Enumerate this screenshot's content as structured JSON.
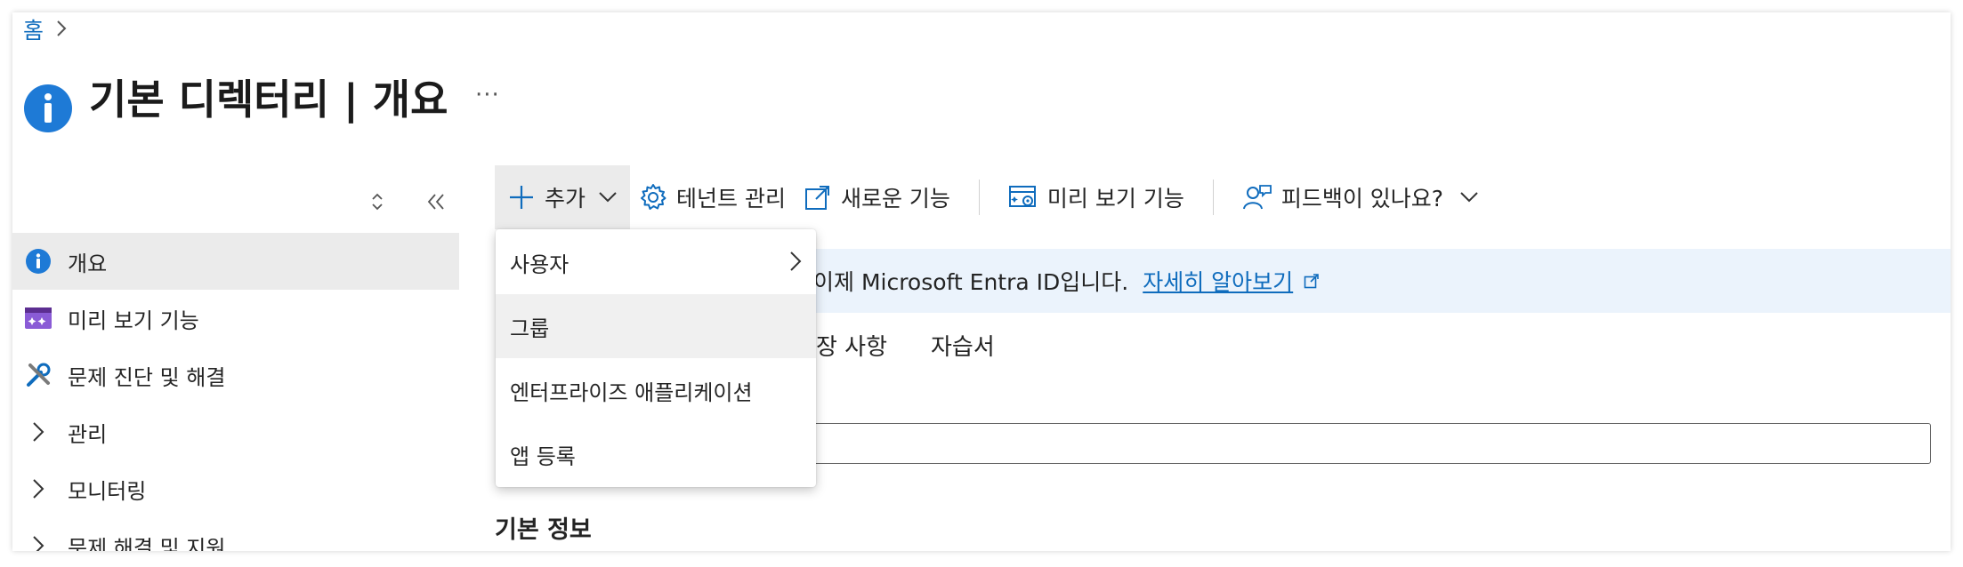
{
  "breadcrumb": {
    "home": "홈",
    "separator": ">"
  },
  "page": {
    "title": "기본 디렉터리 | 개요",
    "more": "···"
  },
  "sidebar": {
    "items": [
      {
        "label": "개요",
        "icon": "info-icon"
      },
      {
        "label": "미리 보기 기능",
        "icon": "preview-features-icon"
      },
      {
        "label": "문제 진단 및 해결",
        "icon": "wrench-tools-icon"
      },
      {
        "label": "관리",
        "icon": "chevron-right-icon"
      },
      {
        "label": "모니터링",
        "icon": "chevron-right-icon"
      },
      {
        "label": "문제 해결 및 지원",
        "icon": "chevron-right-icon"
      }
    ]
  },
  "toolbar": {
    "add": "추가",
    "tenant": "테넌트 관리",
    "whats_new": "새로운 기능",
    "preview": "미리 보기 기능",
    "feedback": "피드백이 있나요?"
  },
  "dropdown": {
    "items": [
      "사용자",
      "그룹",
      "엔터프라이즈 애플리케이션",
      "앱 등록"
    ]
  },
  "banner": {
    "text": "이제 Microsoft Entra ID입니다.",
    "link": "자세히 알아보기"
  },
  "tabs": {
    "partial": "장 사항",
    "tutorial": "자습서"
  },
  "section": {
    "basic_info": "기본 정보"
  },
  "colors": {
    "accent": "#0f6cbd",
    "active_bg": "#ebebeb",
    "banner_bg": "#ebf3fc"
  }
}
